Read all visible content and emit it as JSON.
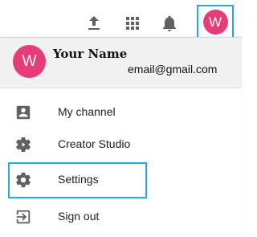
{
  "header": {
    "icons": [
      "upload-icon",
      "apps-grid-icon",
      "notifications-bell-icon"
    ],
    "avatar_initial": "W",
    "avatar_color": "#e53d77",
    "highlight_color": "#29a8e0"
  },
  "account": {
    "avatar_initial": "W",
    "name": "Your Name",
    "email": "email@gmail.com"
  },
  "menu": {
    "items": [
      {
        "label": "My channel",
        "icon": "account-box-icon"
      },
      {
        "label": "Creator Studio",
        "icon": "gear-play-icon"
      },
      {
        "label": "Settings",
        "icon": "gear-icon"
      },
      {
        "label": "Sign out",
        "icon": "sign-out-icon"
      }
    ]
  }
}
